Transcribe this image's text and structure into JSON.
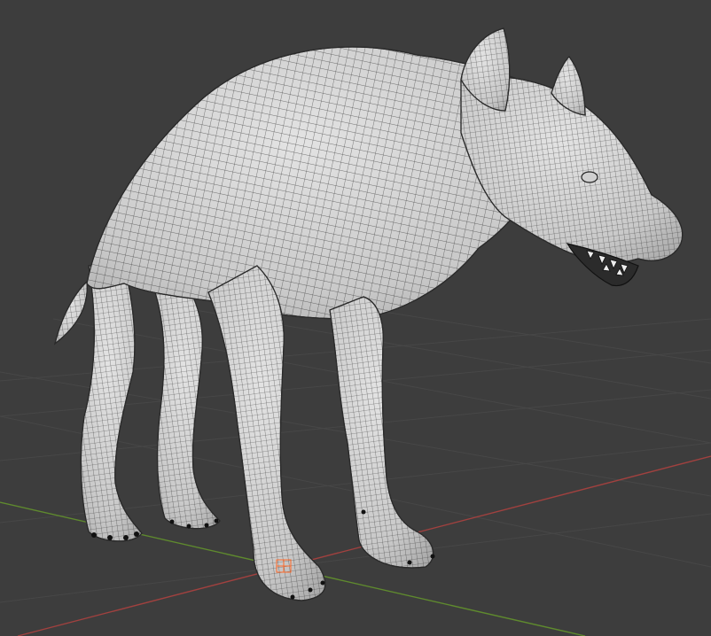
{
  "viewport": {
    "background_color": "#3d3d3d",
    "grid_color": "#474747",
    "x_axis_color": "#a0413f",
    "y_axis_color": "#5f8a2e",
    "selection_color": "#ff6a2a"
  },
  "object": {
    "kind": "hyena-mesh",
    "display": "wireframe-on-shaded",
    "surface_color": "#d6d6d6",
    "wire_color": "#1f1f1f",
    "selected_vertices": "front-right-paw"
  }
}
